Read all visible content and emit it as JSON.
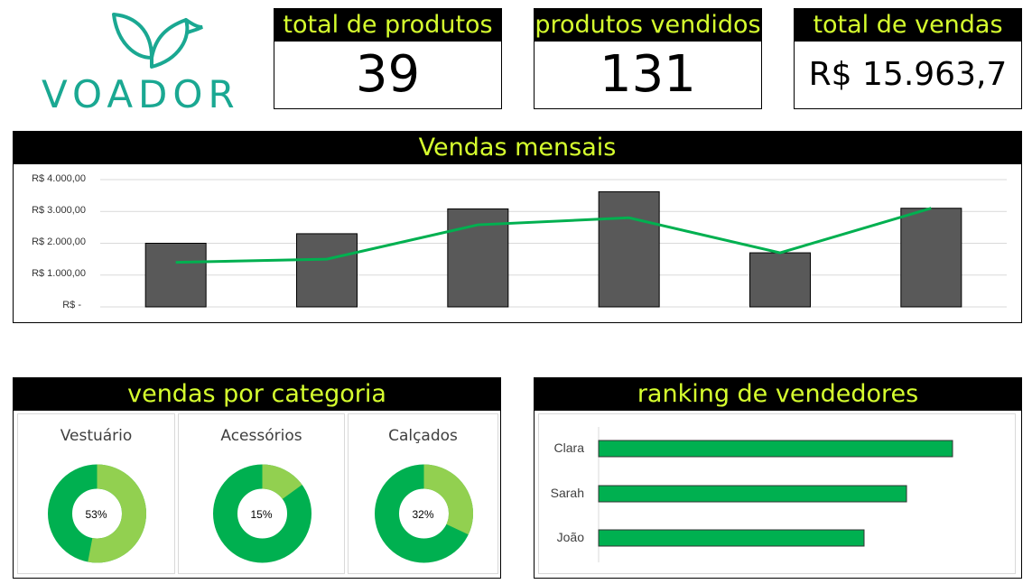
{
  "brand": {
    "name": "VOADOR",
    "color": "#1aa892"
  },
  "kpis": [
    {
      "title": "total de produtos",
      "value": "39"
    },
    {
      "title": "produtos vendidos",
      "value": "131"
    },
    {
      "title": "total de vendas",
      "value": "R$ 15.963,7"
    }
  ],
  "monthly": {
    "title": "Vendas mensais",
    "y_ticks": [
      "R$ 4.000,00",
      "R$ 3.000,00",
      "R$ 2.000,00",
      "R$ 1.000,00",
      "R$ -"
    ]
  },
  "category": {
    "title": "vendas por categoria",
    "items": [
      {
        "name": "Vestuário",
        "label": "53%",
        "percent": 53
      },
      {
        "name": "Acessórios",
        "label": "15%",
        "percent": 15
      },
      {
        "name": "Calçados",
        "label": "32%",
        "percent": 32
      }
    ]
  },
  "ranking": {
    "title": "ranking de vendedores",
    "sellers": [
      "Clara",
      "Sarah",
      "João"
    ]
  },
  "colors": {
    "header_bg": "#000000",
    "header_text": "#d6ff2e",
    "bar": "#595959",
    "line": "#00b050",
    "donut_main": "#00b050",
    "donut_light": "#92d050",
    "rank_bar": "#00b050"
  },
  "chart_data": [
    {
      "type": "bar",
      "title": "Vendas mensais",
      "categories": [],
      "ylim": [
        0,
        4000
      ],
      "grid": true,
      "series": [
        {
          "type": "bar",
          "values": [
            2000,
            2300,
            3080,
            3620,
            1700,
            3100
          ]
        },
        {
          "type": "line",
          "values": [
            1400,
            1500,
            2580,
            2800,
            1700,
            3100
          ]
        }
      ]
    },
    {
      "type": "pie",
      "title": "vendas por categoria",
      "categories": [
        "Vestuário",
        "Acessórios",
        "Calçados"
      ],
      "values": [
        53,
        15,
        32
      ]
    },
    {
      "type": "bar",
      "title": "ranking de vendedores",
      "categories": [
        "Clara",
        "Sarah",
        "João"
      ],
      "values": [
        100,
        87,
        75
      ]
    }
  ]
}
